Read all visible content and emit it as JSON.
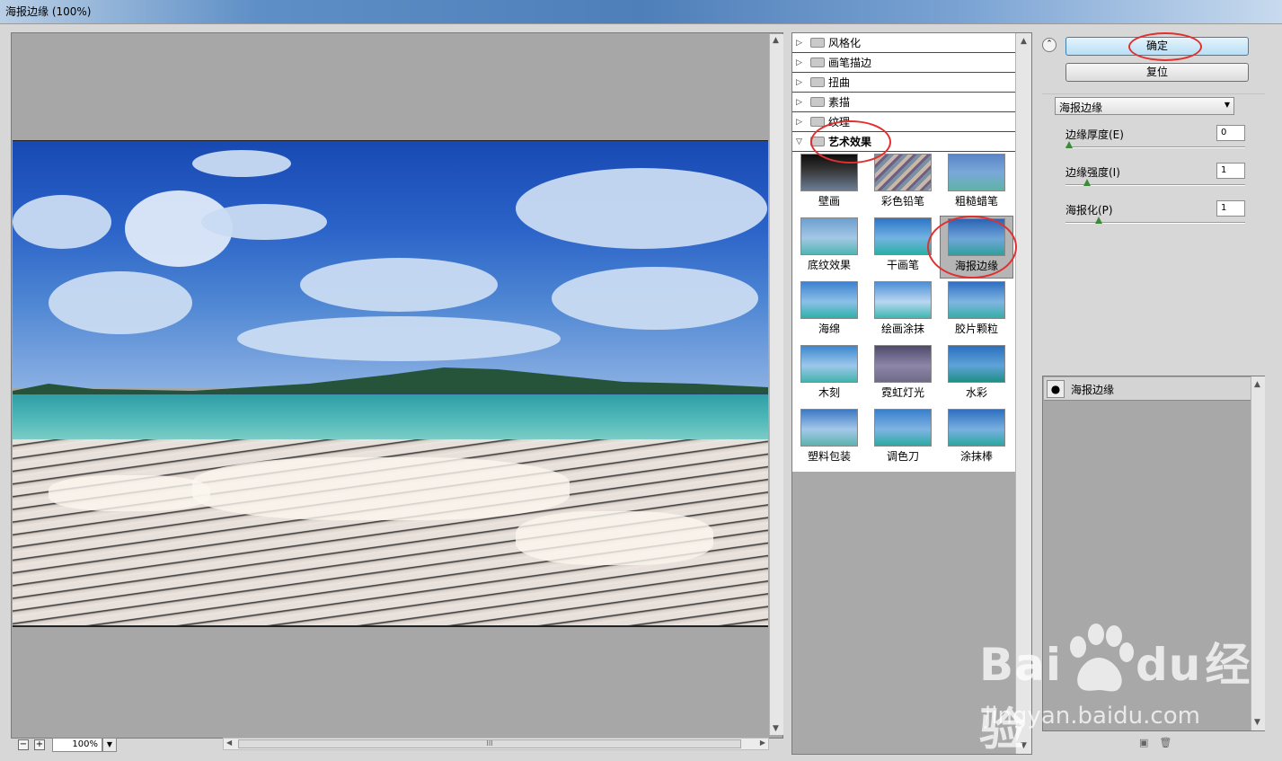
{
  "window": {
    "title": "海报边缘 (100%)"
  },
  "preview": {
    "zoom_value": "100%",
    "zoom_out_label": "−",
    "zoom_in_label": "+",
    "scroll_thumb_grip": "III"
  },
  "gallery": {
    "categories": [
      {
        "label": "风格化"
      },
      {
        "label": "画笔描边"
      },
      {
        "label": "扭曲"
      },
      {
        "label": "素描"
      },
      {
        "label": "纹理"
      },
      {
        "label": "艺术效果"
      }
    ],
    "filters": [
      {
        "label": "壁画"
      },
      {
        "label": "彩色铅笔"
      },
      {
        "label": "粗糙蜡笔"
      },
      {
        "label": "底纹效果"
      },
      {
        "label": "干画笔"
      },
      {
        "label": "海报边缘"
      },
      {
        "label": "海绵"
      },
      {
        "label": "绘画涂抹"
      },
      {
        "label": "胶片颗粒"
      },
      {
        "label": "木刻"
      },
      {
        "label": "霓虹灯光"
      },
      {
        "label": "水彩"
      },
      {
        "label": "塑料包装"
      },
      {
        "label": "调色刀"
      },
      {
        "label": "涂抹棒"
      }
    ],
    "selected_filter": "海报边缘"
  },
  "settings": {
    "ok_label": "确定",
    "reset_label": "复位",
    "filter_select_value": "海报边缘",
    "params": [
      {
        "label": "边缘厚度(E)",
        "value": "0",
        "level": 0.0
      },
      {
        "label": "边缘强度(I)",
        "value": "1",
        "level": 0.1
      },
      {
        "label": "海报化(P)",
        "value": "1",
        "level": 0.17
      }
    ]
  },
  "layers": {
    "items": [
      {
        "label": "海报边缘"
      }
    ]
  },
  "watermark": {
    "brand": "Bai",
    "brand2": "du",
    "cn": "经验",
    "url": "jingyan.baidu.com"
  },
  "colors": {
    "annotation_ring": "#e0302f",
    "ok_button": "#b8def4"
  }
}
